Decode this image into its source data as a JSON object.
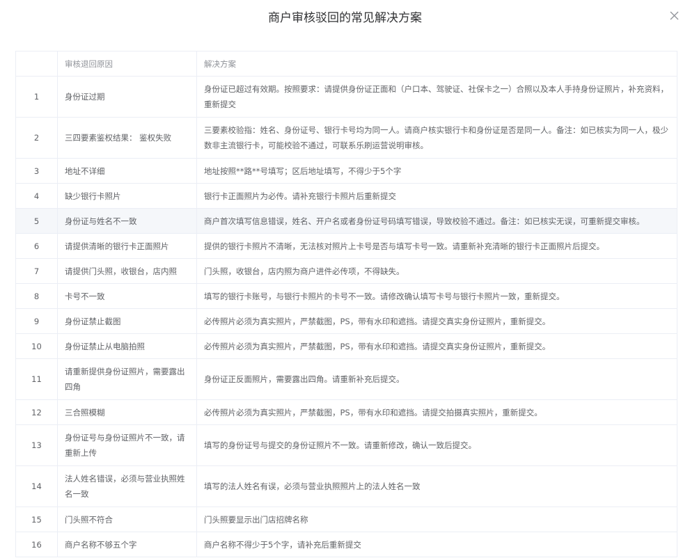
{
  "dialog": {
    "title": "商户审核驳回的常见解决方案"
  },
  "table": {
    "headers": [
      "",
      "审核退回原因",
      "解决方案"
    ],
    "rows": [
      {
        "no": "1",
        "reason": "身份证过期",
        "solution": "身份证已超过有效期。按照要求：请提供身份证正面和（户口本、驾驶证、社保卡之一）合照以及本人手持身份证照片，补充资料，重新提交"
      },
      {
        "no": "2",
        "reason": "三四要素鉴权结果： 鉴权失败",
        "solution": "三要素校验指：姓名、身份证号、银行卡号均为同一人。请商户核实银行卡和身份证是否是同一人。备注：如已核实为同一人，极少数非主流银行卡，可能校验不通过，可联系乐刷运营说明审核。"
      },
      {
        "no": "3",
        "reason": "地址不详细",
        "solution": "地址按照**路**号填写；区后地址填写，不得少于5个字"
      },
      {
        "no": "4",
        "reason": "缺少银行卡照片",
        "solution": "银行卡正面照片为必传。请补充银行卡照片后重新提交"
      },
      {
        "no": "5",
        "reason": "身份证与姓名不一致",
        "solution": "商户首次填写信息错误，姓名、开户名或者身份证号码填写错误，导致校验不通过。备注：如已核实无误，可重新提交审核。"
      },
      {
        "no": "6",
        "reason": "请提供清晰的银行卡正面照片",
        "solution": "提供的银行卡照片不清晰，无法核对照片上卡号是否与填写卡号一致。请重新补充清晰的银行卡正面照片后提交。"
      },
      {
        "no": "7",
        "reason": "请提供门头照，收银台，店内照",
        "solution": "门头照，收银台，店内照为商户进件必传项，不得缺失。"
      },
      {
        "no": "8",
        "reason": "卡号不一致",
        "solution": "填写的银行卡账号，与银行卡照片的卡号不一致。请修改确认填写卡号与银行卡照片一致，重新提交。"
      },
      {
        "no": "9",
        "reason": "身份证禁止截图",
        "solution": "必传照片必须为真实照片，严禁截图，PS，带有水印和遮挡。请提交真实身份证照片，重新提交。"
      },
      {
        "no": "10",
        "reason": "身份证禁止从电脑拍照",
        "solution": "必传照片必须为真实照片，严禁截图，PS，带有水印和遮挡。请提交真实身份证照片，重新提交。"
      },
      {
        "no": "11",
        "reason": "请重新提供身份证照片，需要露出四角",
        "solution": "身份证正反面照片，需要露出四角。请重新补充后提交。"
      },
      {
        "no": "12",
        "reason": "三合照模糊",
        "solution": "必传照片必须为真实照片，严禁截图，PS，带有水印和遮挡。请提交拍摄真实照片，重新提交。"
      },
      {
        "no": "13",
        "reason": "身份证号与身份证照片不一致，请重新上传",
        "solution": "填写的身份证号与提交的身份证照片不一致。请重新修改，确认一致后提交。"
      },
      {
        "no": "14",
        "reason": "法人姓名错误，必须与营业执照姓名一致",
        "solution": "填写的法人姓名有误，必须与营业执照照片上的法人姓名一致"
      },
      {
        "no": "15",
        "reason": "门头照不符合",
        "solution": "门头照要显示出门店招牌名称"
      },
      {
        "no": "16",
        "reason": "商户名称不够五个字",
        "solution": "商户名称不得少于5个字，请补充后重新提交"
      }
    ],
    "highlighted_row": 5
  }
}
